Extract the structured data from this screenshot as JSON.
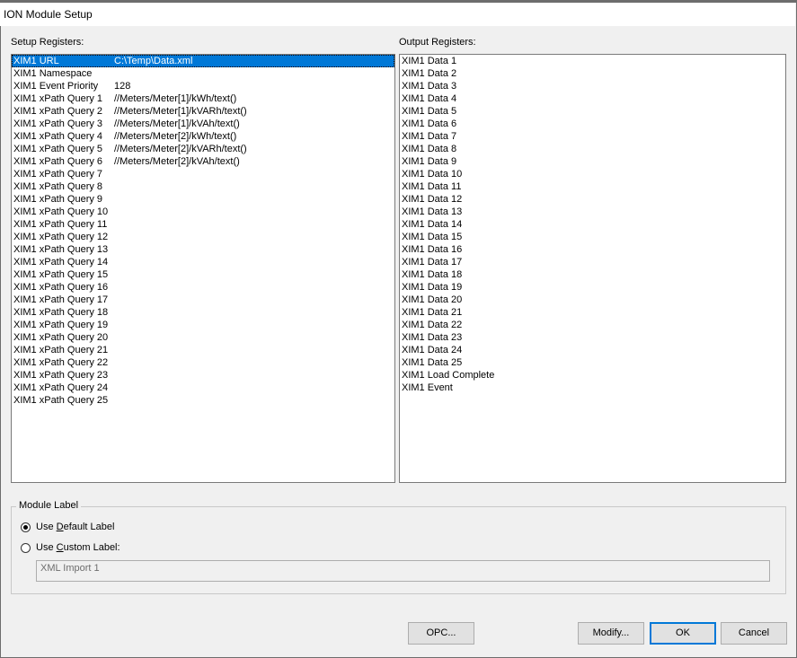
{
  "window": {
    "title": "ION Module Setup"
  },
  "setup_registers": {
    "label": "Setup Registers:",
    "items": [
      {
        "name": "XIM1 URL",
        "value": "C:\\Temp\\Data.xml",
        "selected": true
      },
      {
        "name": "XIM1 Namespace",
        "value": ""
      },
      {
        "name": "XIM1 Event Priority",
        "value": "128"
      },
      {
        "name": "XIM1 xPath Query 1",
        "value": "//Meters/Meter[1]/kWh/text()"
      },
      {
        "name": "XIM1 xPath Query 2",
        "value": "//Meters/Meter[1]/kVARh/text()"
      },
      {
        "name": "XIM1 xPath Query 3",
        "value": "//Meters/Meter[1]/kVAh/text()"
      },
      {
        "name": "XIM1 xPath Query 4",
        "value": "//Meters/Meter[2]/kWh/text()"
      },
      {
        "name": "XIM1 xPath Query 5",
        "value": "//Meters/Meter[2]/kVARh/text()"
      },
      {
        "name": "XIM1 xPath Query 6",
        "value": "//Meters/Meter[2]/kVAh/text()"
      },
      {
        "name": "XIM1 xPath Query 7",
        "value": ""
      },
      {
        "name": "XIM1 xPath Query 8",
        "value": ""
      },
      {
        "name": "XIM1 xPath Query 9",
        "value": ""
      },
      {
        "name": "XIM1 xPath Query 10",
        "value": ""
      },
      {
        "name": "XIM1 xPath Query 11",
        "value": ""
      },
      {
        "name": "XIM1 xPath Query 12",
        "value": ""
      },
      {
        "name": "XIM1 xPath Query 13",
        "value": ""
      },
      {
        "name": "XIM1 xPath Query 14",
        "value": ""
      },
      {
        "name": "XIM1 xPath Query 15",
        "value": ""
      },
      {
        "name": "XIM1 xPath Query 16",
        "value": ""
      },
      {
        "name": "XIM1 xPath Query 17",
        "value": ""
      },
      {
        "name": "XIM1 xPath Query 18",
        "value": ""
      },
      {
        "name": "XIM1 xPath Query 19",
        "value": ""
      },
      {
        "name": "XIM1 xPath Query 20",
        "value": ""
      },
      {
        "name": "XIM1 xPath Query 21",
        "value": ""
      },
      {
        "name": "XIM1 xPath Query 22",
        "value": ""
      },
      {
        "name": "XIM1 xPath Query 23",
        "value": ""
      },
      {
        "name": "XIM1 xPath Query 24",
        "value": ""
      },
      {
        "name": "XIM1 xPath Query 25",
        "value": ""
      }
    ]
  },
  "output_registers": {
    "label": "Output Registers:",
    "items": [
      "XIM1 Data 1",
      "XIM1 Data 2",
      "XIM1 Data 3",
      "XIM1 Data 4",
      "XIM1 Data 5",
      "XIM1 Data 6",
      "XIM1 Data 7",
      "XIM1 Data 8",
      "XIM1 Data 9",
      "XIM1 Data 10",
      "XIM1 Data 11",
      "XIM1 Data 12",
      "XIM1 Data 13",
      "XIM1 Data 14",
      "XIM1 Data 15",
      "XIM1 Data 16",
      "XIM1 Data 17",
      "XIM1 Data 18",
      "XIM1 Data 19",
      "XIM1 Data 20",
      "XIM1 Data 21",
      "XIM1 Data 22",
      "XIM1 Data 23",
      "XIM1 Data 24",
      "XIM1 Data 25",
      "XIM1 Load Complete",
      "XIM1 Event"
    ]
  },
  "module_label": {
    "group_label": "Module Label",
    "default_option": {
      "pre": "Use ",
      "mnemonic": "D",
      "post": "efault Label",
      "checked": true
    },
    "custom_option": {
      "pre": "Use ",
      "mnemonic": "C",
      "post": "ustom Label:",
      "checked": false
    },
    "custom_value": "XML Import 1"
  },
  "buttons": {
    "opc": "OPC...",
    "modify": "Modify...",
    "ok": "OK",
    "cancel": "Cancel"
  }
}
